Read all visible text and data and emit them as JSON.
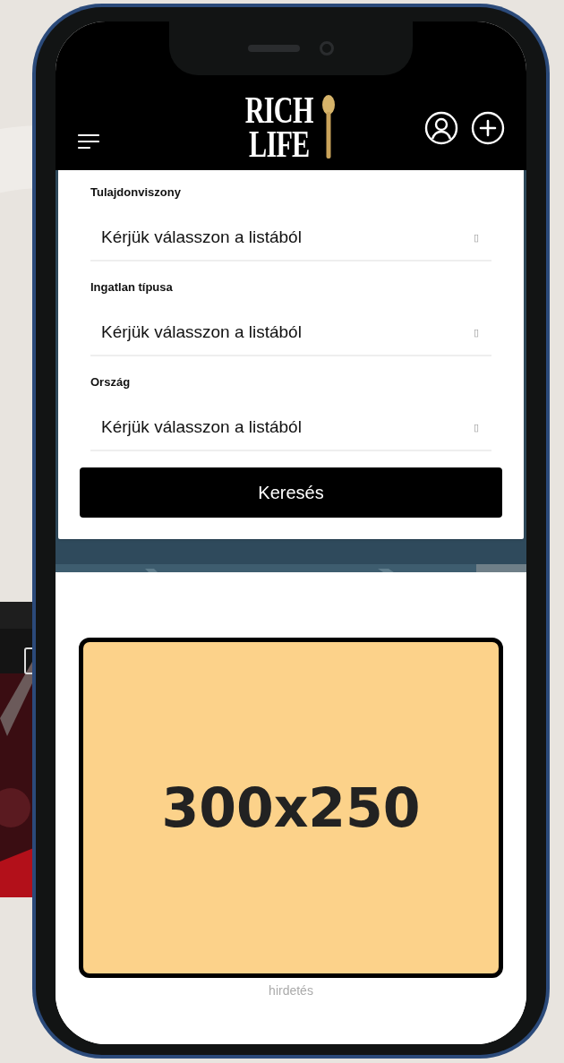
{
  "header": {
    "logo": [
      "RICH",
      "LIFE"
    ]
  },
  "form": {
    "fields": [
      {
        "label": "Tulajdonviszony",
        "placeholder": "Kérjük válasszon a listából",
        "indicator": "▯"
      },
      {
        "label": "Ingatlan típusa",
        "placeholder": "Kérjük válasszon a listából",
        "indicator": "▯"
      },
      {
        "label": "Ország",
        "placeholder": "Kérjük válasszon a listából",
        "indicator": "▯"
      }
    ],
    "button": "Keresés"
  },
  "ad": {
    "size": "300x250",
    "caption": "hirdetés"
  }
}
